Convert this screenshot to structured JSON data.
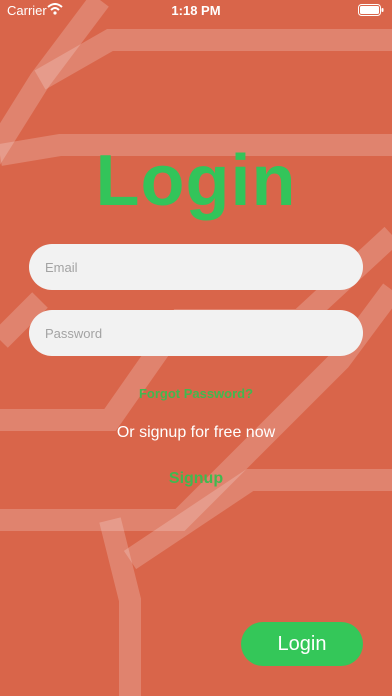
{
  "status_bar": {
    "carrier": "Carrier",
    "time": "1:18 PM"
  },
  "login": {
    "title": "Login",
    "email_placeholder": "Email",
    "password_placeholder": "Password",
    "forgot_password": "Forgot Password?",
    "signup_prompt": "Or signup for free now",
    "signup_link": "Signup",
    "login_button": "Login"
  },
  "colors": {
    "background": "#d9654a",
    "accent_green": "#34c759",
    "field_background": "#f2f2f2"
  },
  "icons": [
    "wifi-icon",
    "battery-icon"
  ]
}
